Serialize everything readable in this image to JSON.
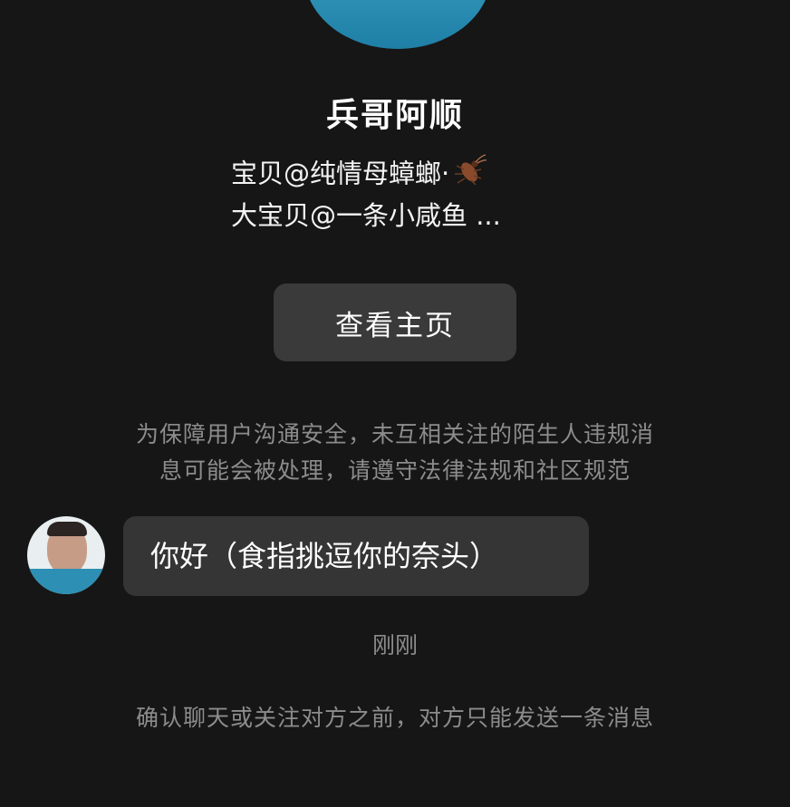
{
  "profile": {
    "name": "兵哥阿顺",
    "bio_line1": "宝贝@纯情母蟑螂·",
    "bio_line2": "大宝贝@一条小咸鱼 ...",
    "bio_emoji": "cockroach-icon",
    "view_profile_label": "查看主页"
  },
  "notice": {
    "line1": "为保障用户沟通安全，未互相关注的陌生人违规消",
    "line2": "息可能会被处理，请遵守法律法规和社区规范"
  },
  "messages": [
    {
      "text": "你好（食指挑逗你的奈头）",
      "time": "刚刚"
    }
  ],
  "footer": {
    "note": "确认聊天或关注对方之前，对方只能发送一条消息"
  },
  "colors": {
    "background": "#161616",
    "button": "#3a3a3a",
    "bubble": "#353535",
    "muted_text": "#8c8c8c"
  }
}
